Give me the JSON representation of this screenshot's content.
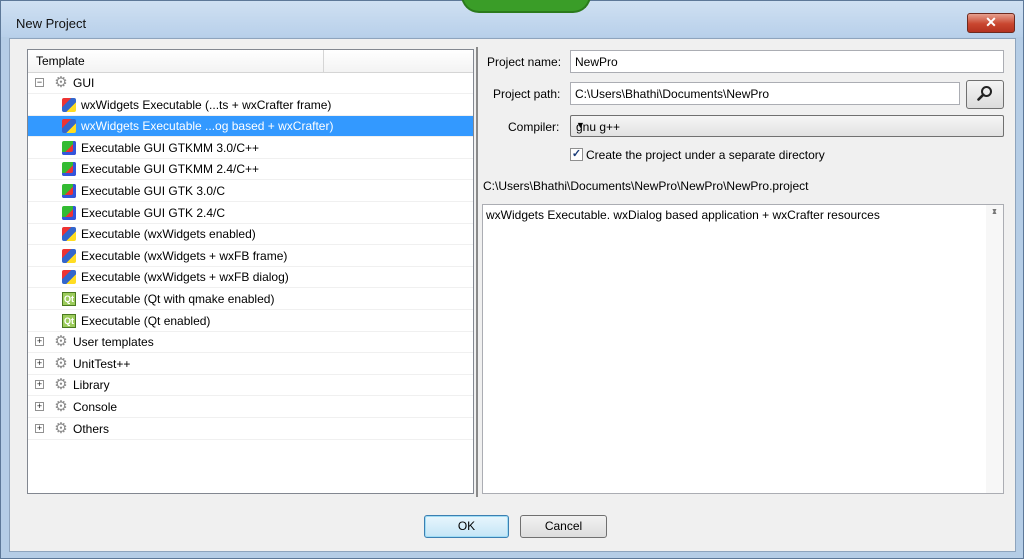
{
  "window": {
    "title": "New Project",
    "close_glyph": "✕"
  },
  "tree": {
    "header": "Template",
    "rows": [
      {
        "label": "GUI",
        "kind": "group",
        "expanded": true,
        "icon": "gear-icon"
      },
      {
        "label": "wxWidgets Executable (...ts + wxCrafter frame)",
        "kind": "item",
        "icon": "wxwidgets-icon"
      },
      {
        "label": "wxWidgets Executable ...og based + wxCrafter)",
        "kind": "item",
        "icon": "wxwidgets-icon",
        "selected": true
      },
      {
        "label": "Executable GUI GTKMM 3.0/C++",
        "kind": "item",
        "icon": "gtk-icon"
      },
      {
        "label": "Executable GUI GTKMM 2.4/C++",
        "kind": "item",
        "icon": "gtk-icon"
      },
      {
        "label": "Executable GUI GTK 3.0/C",
        "kind": "item",
        "icon": "gtk-icon"
      },
      {
        "label": "Executable GUI GTK 2.4/C",
        "kind": "item",
        "icon": "gtk-icon"
      },
      {
        "label": "Executable (wxWidgets enabled)",
        "kind": "item",
        "icon": "wxwidgets-icon"
      },
      {
        "label": "Executable (wxWidgets + wxFB frame)",
        "kind": "item",
        "icon": "wxwidgets-icon"
      },
      {
        "label": "Executable (wxWidgets + wxFB dialog)",
        "kind": "item",
        "icon": "wxwidgets-icon"
      },
      {
        "label": "Executable (Qt with qmake enabled)",
        "kind": "item",
        "icon": "qt-icon"
      },
      {
        "label": "Executable (Qt enabled)",
        "kind": "item",
        "icon": "qt-icon"
      },
      {
        "label": "User templates",
        "kind": "group",
        "expanded": false,
        "icon": "gear-icon"
      },
      {
        "label": "UnitTest++",
        "kind": "group",
        "expanded": false,
        "icon": "gear-icon"
      },
      {
        "label": "Library",
        "kind": "group",
        "expanded": false,
        "icon": "gear-icon"
      },
      {
        "label": "Console",
        "kind": "group",
        "expanded": false,
        "icon": "gear-icon"
      },
      {
        "label": "Others",
        "kind": "group",
        "expanded": false,
        "icon": "gear-icon"
      }
    ]
  },
  "form": {
    "project_name_label": "Project name:",
    "project_name_value": "NewPro",
    "project_path_label": "Project path:",
    "project_path_value": "C:\\Users\\Bhathi\\Documents\\NewPro",
    "browse_icon": "magnifier-icon",
    "compiler_label": "Compiler:",
    "compiler_value": "gnu g++",
    "separate_dir_label": "Create the project under a separate directory",
    "separate_dir_checked": true,
    "full_path": "C:\\Users\\Bhathi\\Documents\\NewPro\\NewPro\\NewPro.project",
    "description": "wxWidgets Executable. wxDialog based application + wxCrafter resources"
  },
  "buttons": {
    "ok": "OK",
    "cancel": "Cancel"
  }
}
